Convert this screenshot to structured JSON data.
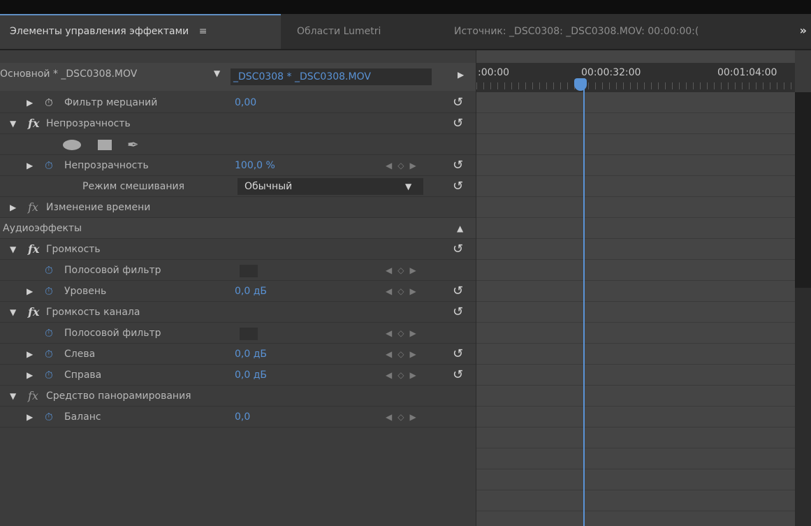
{
  "tabs": {
    "effect_controls": "Элементы управления эффектами",
    "lumetri": "Области Lumetri",
    "source": "Источник: _DSC0308: _DSC0308.MOV: 00:00:00:(",
    "overflow": "»"
  },
  "header": {
    "master_clip": "Основной * _DSC0308.MOV",
    "sequence_clip": "_DSC0308 * _DSC0308.MOV"
  },
  "timeline": {
    "t0": ":00:00",
    "t1": "00:00:32:00",
    "t2": "00:01:04:00"
  },
  "rows": {
    "flicker_label": "Фильтр мерцаний",
    "flicker_value": "0,00",
    "opacity_effect": "Непрозрачность",
    "opacity_label": "Непрозрачность",
    "opacity_value": "100,0 %",
    "blend_label": "Режим смешивания",
    "blend_value": "Обычный",
    "time_remap": "Изменение времени",
    "audio_effects": "Аудиоэффекты",
    "volume_effect": "Громкость",
    "bypass_label": "Полосовой фильтр",
    "level_label": "Уровень",
    "level_value": "0,0 дБ",
    "channel_volume_effect": "Громкость канала",
    "bypass_label_2": "Полосовой фильтр",
    "left_label": "Слева",
    "left_value": "0,0 дБ",
    "right_label": "Справа",
    "right_value": "0,0 дБ",
    "panner_effect": "Средство панорамирования",
    "balance_label": "Баланс",
    "balance_value": "0,0"
  },
  "colors": {
    "accent": "#5a93d6",
    "panel_bg": "#3c3c3c",
    "timeline_bg": "#454545"
  }
}
